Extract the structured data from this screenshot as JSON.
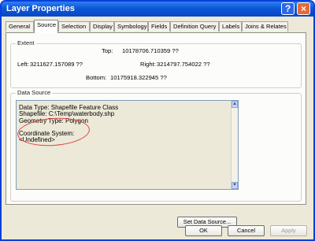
{
  "window": {
    "title": "Layer Properties",
    "help_symbol": "?",
    "close_symbol": "×"
  },
  "tabs": [
    {
      "label": "General"
    },
    {
      "label": "Source"
    },
    {
      "label": "Selection"
    },
    {
      "label": "Display"
    },
    {
      "label": "Symbology"
    },
    {
      "label": "Fields"
    },
    {
      "label": "Definition Query"
    },
    {
      "label": "Labels"
    },
    {
      "label": "Joins & Relates"
    }
  ],
  "extent": {
    "legend": "Extent",
    "top_label": "Top:",
    "top_value": "10178706.710359 ??",
    "left_label": "Left:",
    "left_value": "3211627.157089 ??",
    "right_label": "Right:",
    "right_value": "3214797.754022 ??",
    "bottom_label": "Bottom:",
    "bottom_value": "10175918.322945 ??"
  },
  "data_source": {
    "legend": "Data Source",
    "lines": [
      "Data Type: Shapefile Feature Class",
      "Shapefile: C:\\Temp\\waterbody.shp",
      "Geometry Type: Polygon",
      "",
      "Coordinate System:",
      "<Undefined>"
    ],
    "set_button": "Set Data Source..."
  },
  "footer": {
    "ok": "OK",
    "cancel": "Cancel",
    "apply": "Apply"
  }
}
